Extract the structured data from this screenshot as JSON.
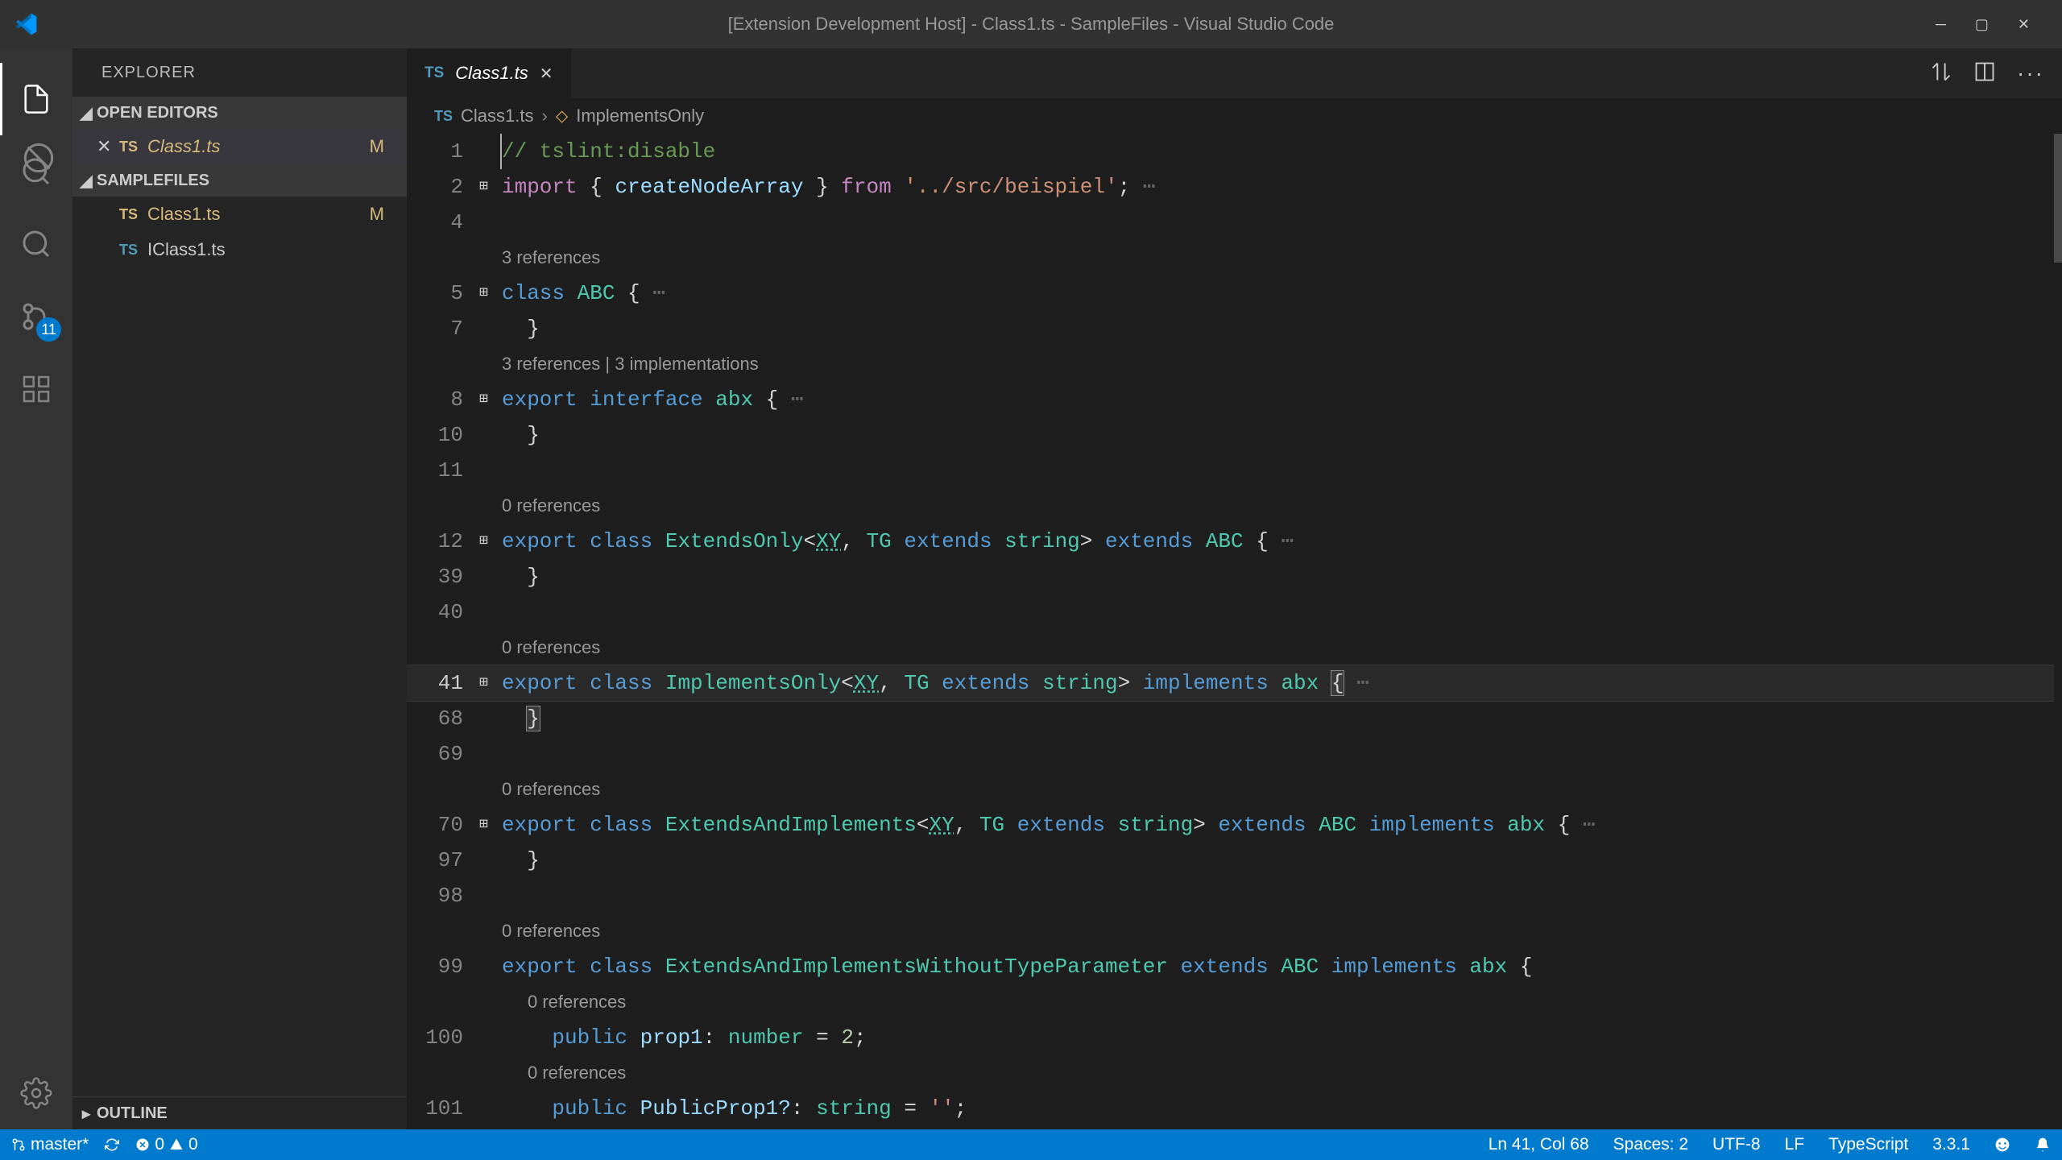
{
  "window": {
    "title": "[Extension Development Host] - Class1.ts - SampleFiles - Visual Studio Code"
  },
  "activity": {
    "scm_badge": "11"
  },
  "sidebar": {
    "title": "EXPLORER",
    "open_editors": {
      "label": "OPEN EDITORS",
      "items": [
        {
          "name": "Class1.ts",
          "modified": true,
          "badge": "M"
        }
      ]
    },
    "folder": {
      "label": "SAMPLEFILES",
      "items": [
        {
          "name": "Class1.ts",
          "modified": true,
          "badge": "M"
        },
        {
          "name": "IClass1.ts",
          "modified": false
        }
      ]
    },
    "outline": {
      "label": "OUTLINE"
    }
  },
  "tabs": {
    "open": [
      {
        "label": "Class1.ts"
      }
    ]
  },
  "breadcrumb": {
    "file": "Class1.ts",
    "symbol": "ImplementsOnly"
  },
  "codelens": {
    "abc": "3 references",
    "abx": "3 references | 3 implementations",
    "extendsOnly": "0 references",
    "implementsOnly": "0 references",
    "extendsAndImplements": "0 references",
    "extendsAndImplementsWithoutTP": "0 references",
    "prop1": "0 references",
    "publicProp1": "0 references"
  },
  "code": {
    "l1_comment": "// tslint:disable",
    "l2": {
      "import": "import",
      "brace_open": " { ",
      "createNodeArray": "createNodeArray",
      "brace_close": " } ",
      "from": "from",
      "path": " '../src/beispiel'",
      "end": ";"
    },
    "l5": {
      "class": "class",
      "name": " ABC ",
      "brace": "{"
    },
    "l7": "  }",
    "l8": {
      "export": "export",
      "interface": " interface",
      "name": " abx ",
      "brace": "{"
    },
    "l10": "  }",
    "l12": {
      "export": "export",
      "class": " class",
      "name": " ExtendsOnly",
      "lt": "<",
      "xy": "XY",
      "comma": ", ",
      "tg": "TG ",
      "extends": "extends",
      "string": " string",
      "gt": "> ",
      "extends2": "extends",
      "abc": " ABC ",
      "brace": "{"
    },
    "l39": "  }",
    "l41": {
      "export": "export",
      "class": " class",
      "name": " ImplementsOnly",
      "lt": "<",
      "xy": "XY",
      "comma": ", ",
      "tg": "TG ",
      "extends": "extends",
      "string": " string",
      "gt": "> ",
      "implements": "implements",
      "abx": " abx ",
      "brace": "{"
    },
    "l68": "  }",
    "l70": {
      "export": "export",
      "class": " class",
      "name": " ExtendsAndImplements",
      "lt": "<",
      "xy": "XY",
      "comma": ", ",
      "tg": "TG ",
      "extends": "extends",
      "string": " string",
      "gt": "> ",
      "extends2": "extends",
      "abc": " ABC ",
      "implements": "implements",
      "abx": " abx ",
      "brace": "{"
    },
    "l97": "  }",
    "l99": {
      "export": "export",
      "class": " class",
      "name": " ExtendsAndImplementsWithoutTypeParameter ",
      "extends": "extends",
      "abc": " ABC ",
      "implements": "implements",
      "abx": " abx ",
      "brace": "{"
    },
    "l100": {
      "public": "public",
      "name": " prop1",
      "colon": ": ",
      "type": "number",
      "eq": " = ",
      "val": "2",
      "end": ";"
    },
    "l101": {
      "public": "public",
      "name": " PublicProp1?",
      "colon": ": ",
      "type": "string",
      "eq": " = ",
      "val": "''",
      "end": ";"
    }
  },
  "line_numbers": [
    "1",
    "2",
    "4",
    "5",
    "7",
    "8",
    "10",
    "11",
    "12",
    "39",
    "40",
    "41",
    "68",
    "69",
    "70",
    "97",
    "98",
    "99",
    "100",
    "101"
  ],
  "status": {
    "branch": "master*",
    "errors": "0",
    "warnings": "0",
    "ln_col": "Ln 41, Col 68",
    "spaces": "Spaces: 2",
    "encoding": "UTF-8",
    "eol": "LF",
    "language": "TypeScript",
    "ts_version": "3.3.1"
  }
}
